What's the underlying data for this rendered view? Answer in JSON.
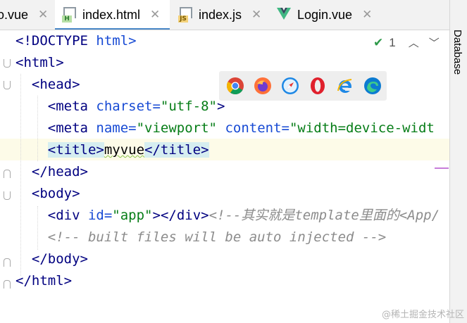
{
  "tabs": [
    {
      "label": "o.vue",
      "type": "vue",
      "active": false
    },
    {
      "label": "index.html",
      "type": "html",
      "active": true
    },
    {
      "label": "index.js",
      "type": "js",
      "active": false
    },
    {
      "label": "Login.vue",
      "type": "vue",
      "active": false
    }
  ],
  "sidebar": {
    "database_label": "Database"
  },
  "inspection": {
    "count": "1"
  },
  "browsers": [
    "chrome-icon",
    "firefox-icon",
    "safari-icon",
    "opera-icon",
    "ie-icon",
    "edge-icon"
  ],
  "code": {
    "l1": {
      "tag": "<!DOCTYPE",
      "rest": " html>"
    },
    "l2": {
      "tag": "<html>"
    },
    "l3": {
      "tag": "<head>"
    },
    "l4": {
      "open": "<meta ",
      "attr": "charset=",
      "val": "\"utf-8\"",
      "close": ">"
    },
    "l5": {
      "open": "<meta ",
      "attr1": "name=",
      "val1": "\"viewport\"",
      "attr2": " content=",
      "val2": "\"width=device-widt"
    },
    "l6": {
      "open": "<title>",
      "text": "myvue",
      "close": "</title>"
    },
    "l7": {
      "tag": "</head>"
    },
    "l8": {
      "tag": "<body>"
    },
    "l9": {
      "open": "<div ",
      "attr": "id=",
      "val": "\"app\"",
      "close": "></div>",
      "comment": "<!--其实就是template里面的<App/"
    },
    "l10": {
      "comment": "<!-- built files will be auto injected -->"
    },
    "l11": {
      "tag": "</body>"
    },
    "l12": {
      "tag": "</html>"
    }
  },
  "colors": {
    "tag": "#000080",
    "attr": "#174ad4",
    "string": "#067d17",
    "comment": "#8c8c8c",
    "accent": "#4a88c7"
  },
  "watermark": "@稀土掘金技术社区"
}
